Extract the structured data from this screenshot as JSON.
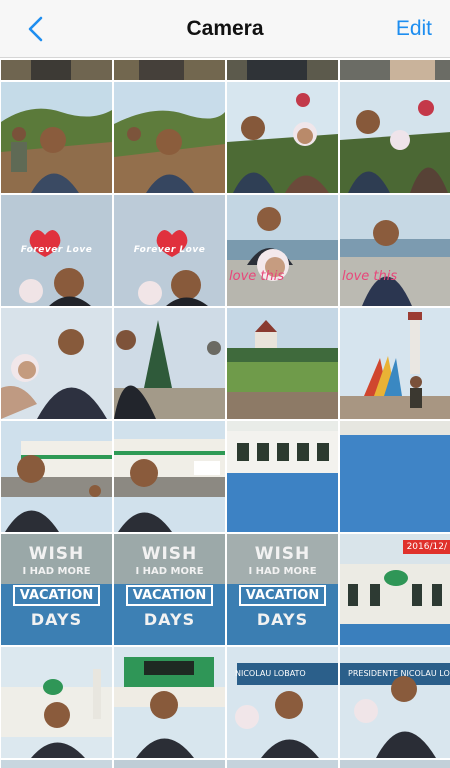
{
  "header": {
    "title": "Camera",
    "edit_label": "Edit",
    "back_icon": "chevron-left-icon",
    "accent_color": "#1e8ef0"
  },
  "overlays": {
    "forever_love": "Forever Love",
    "love_this": "love this",
    "vacation_1": "WISH",
    "vacation_2": "I HAD MORE",
    "vacation_3": "VACATION",
    "vacation_4": "DAYS",
    "date_stamp": "2016/12/",
    "sign_1": "NICOLAU LOBATO",
    "sign_2": "PRESIDENTE NICOLAU LOBATO"
  }
}
